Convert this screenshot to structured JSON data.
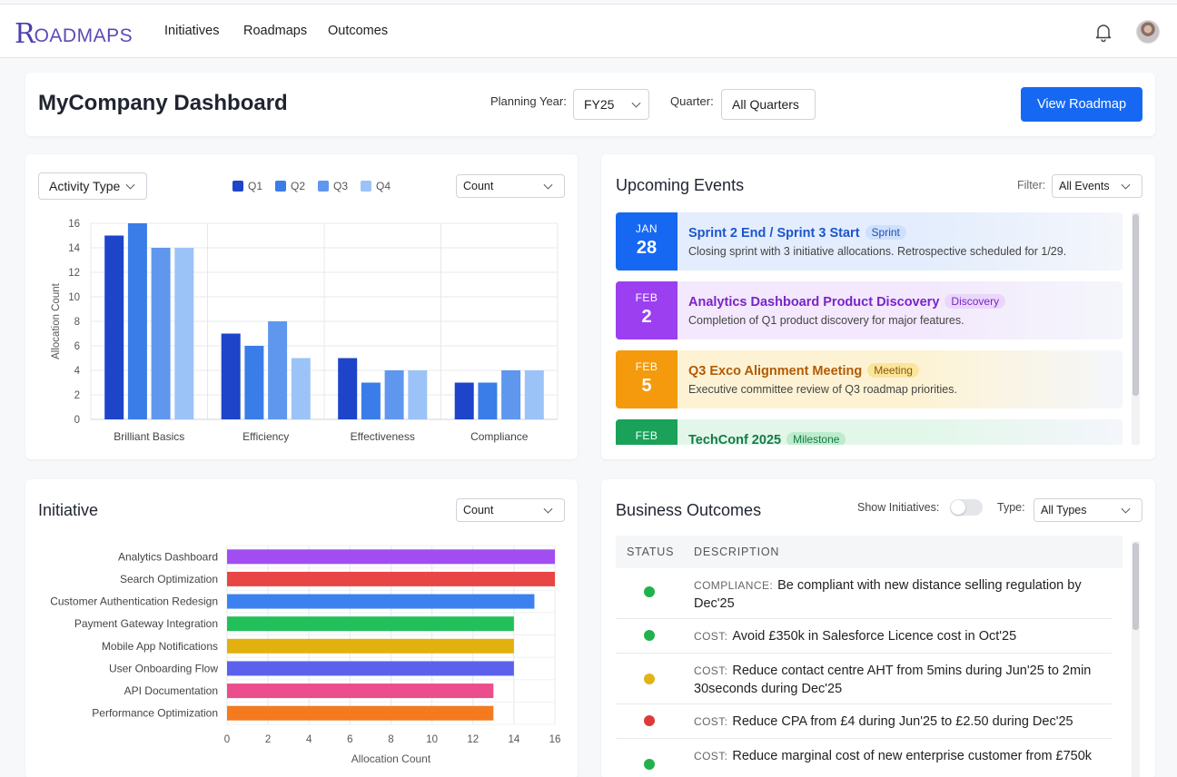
{
  "nav": {
    "logo_initial": "R",
    "logo_rest": "OADMAPS",
    "links": [
      "Initiatives",
      "Roadmaps",
      "Outcomes"
    ]
  },
  "header": {
    "title": "MyCompany Dashboard",
    "planning_year_label": "Planning Year:",
    "planning_year_value": "FY25",
    "quarter_label": "Quarter:",
    "quarter_value": "All Quarters",
    "view_roadmap_label": "View Roadmap"
  },
  "activity": {
    "type_select": "Activity Type",
    "metric_select": "Count",
    "legend": [
      {
        "name": "Q1",
        "color": "#1d44c9"
      },
      {
        "name": "Q2",
        "color": "#3a7de8"
      },
      {
        "name": "Q3",
        "color": "#5f97ee"
      },
      {
        "name": "Q4",
        "color": "#9cc3f7"
      }
    ]
  },
  "initiative": {
    "title": "Initiative",
    "metric_select": "Count"
  },
  "events": {
    "title": "Upcoming Events",
    "filter_label": "Filter:",
    "filter_value": "All Events",
    "items": [
      {
        "month": "JAN",
        "day": "28",
        "title": "Sprint 2 End / Sprint 3 Start",
        "tag": "Sprint",
        "desc": "Closing sprint with 3 initiative allocations. Retrospective scheduled for 1/29.",
        "accent": "#1668f2",
        "bg": "#e3edfd",
        "title_color": "#1c55cc",
        "tag_bg": "#cfe0fb",
        "tag_color": "#1d4fb0"
      },
      {
        "month": "FEB",
        "day": "2",
        "title": "Analytics Dashboard Product Discovery",
        "tag": "Discovery",
        "desc": "Completion of Q1 product discovery for major features.",
        "accent": "#9b3ff0",
        "bg": "#f3e8fd",
        "title_color": "#7a24c8",
        "tag_bg": "#ead7fb",
        "tag_color": "#7a24c8"
      },
      {
        "month": "FEB",
        "day": "5",
        "title": "Q3 Exco Alignment Meeting",
        "tag": "Meeting",
        "desc": "Executive committee review of Q3 roadmap priorities.",
        "accent": "#f49a0c",
        "bg": "#fdf3d4",
        "title_color": "#b25a06",
        "tag_bg": "#fbe59a",
        "tag_color": "#8a5a05"
      },
      {
        "month": "FEB",
        "day": "",
        "title": "TechConf 2025",
        "tag": "Milestone",
        "desc": "",
        "accent": "#1aa15a",
        "bg": "#e2f7ea",
        "title_color": "#147a45",
        "tag_bg": "#bdeccd",
        "tag_color": "#147a45"
      }
    ]
  },
  "outcomes": {
    "title": "Business Outcomes",
    "show_initiatives_label": "Show Initiatives:",
    "show_initiatives": false,
    "type_label": "Type:",
    "type_value": "All Types",
    "col_status": "STATUS",
    "col_description": "DESCRIPTION",
    "rows": [
      {
        "status": "green",
        "color": "#22b24c",
        "category": "COMPLIANCE:",
        "text": "Be compliant with new distance selling regulation by Dec'25"
      },
      {
        "status": "green",
        "color": "#22b24c",
        "category": "COST:",
        "text": "Avoid £350k in Salesforce Licence cost in Oct'25"
      },
      {
        "status": "amber",
        "color": "#e0b416",
        "category": "COST:",
        "text": "Reduce contact centre AHT from 5mins during Jun'25 to 2min 30seconds during Dec'25"
      },
      {
        "status": "red",
        "color": "#dd3a3a",
        "category": "COST:",
        "text": "Reduce CPA from £4 during Jun'25 to £2.50 during Dec'25"
      },
      {
        "status": "green",
        "color": "#22b24c",
        "category": "COST:",
        "text": "Reduce marginal cost of new enterprise customer from £750k"
      }
    ]
  },
  "chart_data": [
    {
      "type": "bar",
      "title": "",
      "xlabel": "",
      "ylabel": "Allocation Count",
      "categories": [
        "Brilliant Basics",
        "Efficiency",
        "Effectiveness",
        "Compliance"
      ],
      "ylim": [
        0,
        16
      ],
      "yticks": [
        "0",
        "2",
        "4",
        "6",
        "8",
        "10",
        "12",
        "14",
        "16"
      ],
      "grid": true,
      "legend": "top",
      "series": [
        {
          "name": "Q1",
          "color": "#1d44c9",
          "values": [
            15,
            7,
            5,
            3
          ]
        },
        {
          "name": "Q2",
          "color": "#3a7de8",
          "values": [
            16,
            6,
            3,
            3
          ]
        },
        {
          "name": "Q3",
          "color": "#5f97ee",
          "values": [
            14,
            8,
            4,
            4
          ]
        },
        {
          "name": "Q4",
          "color": "#9cc3f7",
          "values": [
            14,
            5,
            4,
            4
          ]
        }
      ]
    },
    {
      "type": "bar",
      "orientation": "horizontal",
      "title": "",
      "xlabel": "Allocation Count",
      "ylabel": "",
      "xlim": [
        0,
        16
      ],
      "xticks": [
        "0",
        "2",
        "4",
        "6",
        "8",
        "10",
        "12",
        "14",
        "16"
      ],
      "grid": true,
      "categories": [
        "Analytics Dashboard",
        "Search Optimization",
        "Customer Authentication Redesign",
        "Payment Gateway Integration",
        "Mobile App Notifications",
        "User Onboarding Flow",
        "API Documentation",
        "Performance Optimization"
      ],
      "values": [
        16,
        16,
        15,
        14,
        14,
        14,
        13,
        13
      ],
      "colors": [
        "#a24df2",
        "#e84545",
        "#3b82f0",
        "#22c05a",
        "#e2b10f",
        "#5b61ec",
        "#ec4d8c",
        "#f47a1f"
      ]
    }
  ]
}
